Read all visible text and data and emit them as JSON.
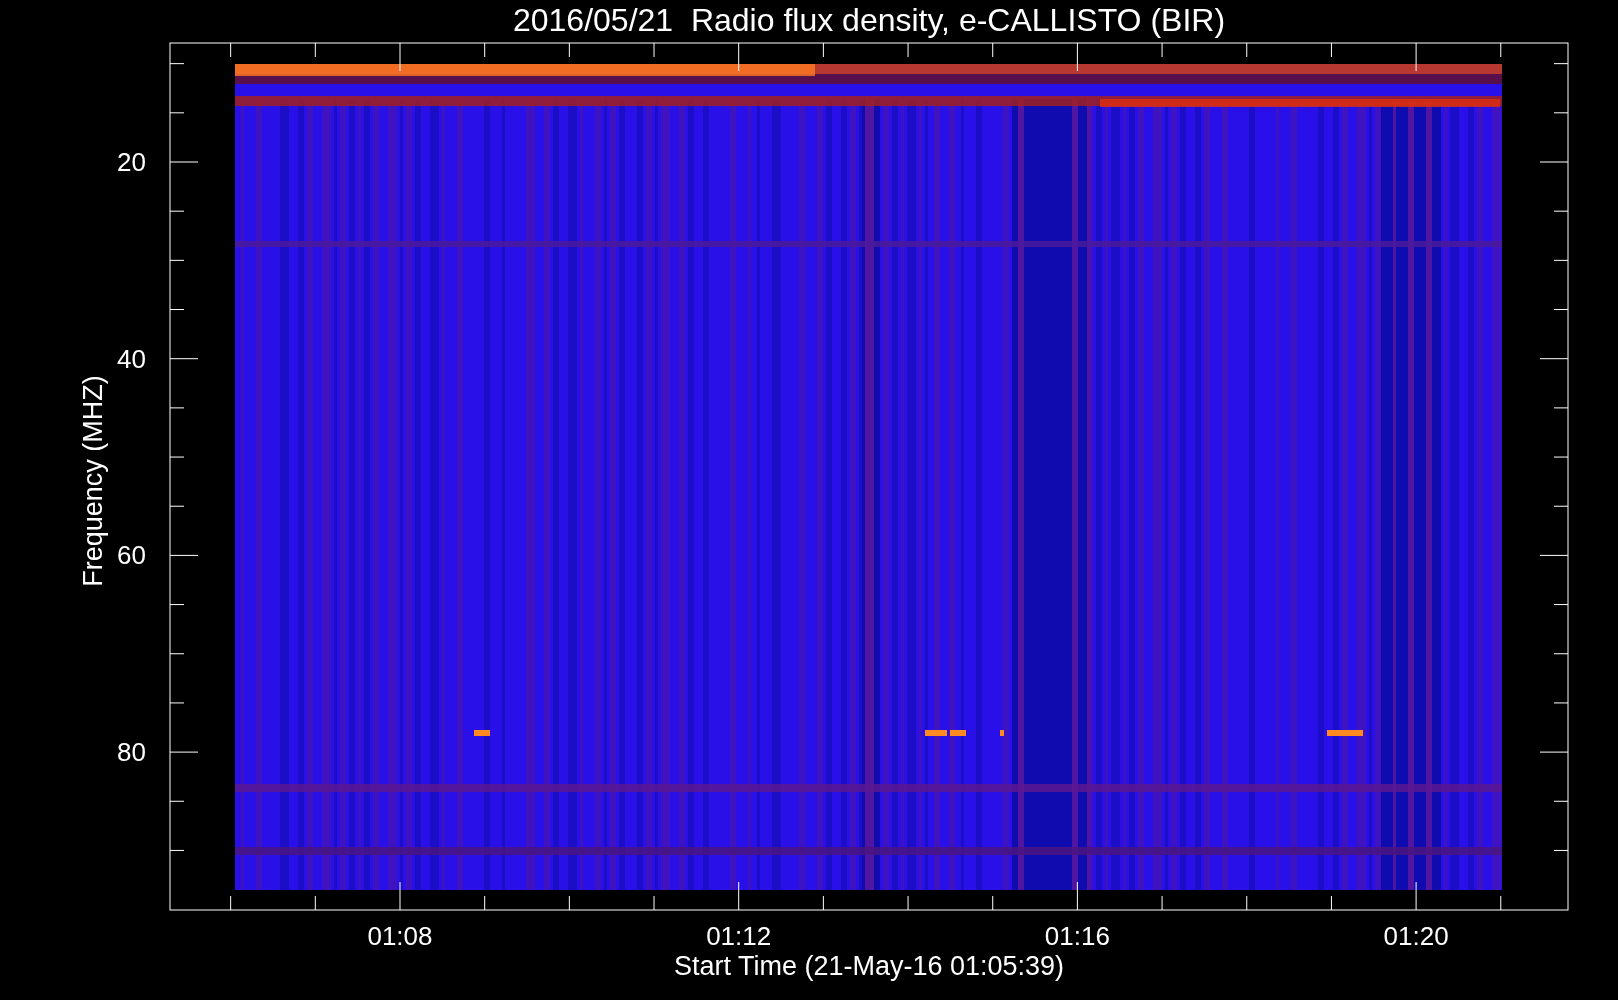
{
  "title": "2016/05/21  Radio flux density, e-CALLISTO (BIR)",
  "xlabel": "Start Time (21-May-16 01:05:39)",
  "ylabel": "Frequency (MHZ)",
  "yticks": [
    {
      "label": "20"
    },
    {
      "label": "40"
    },
    {
      "label": "60"
    },
    {
      "label": "80"
    }
  ],
  "xticks": [
    {
      "label": "01:08"
    },
    {
      "label": "01:12"
    },
    {
      "label": "01:16"
    },
    {
      "label": "01:20"
    }
  ]
}
